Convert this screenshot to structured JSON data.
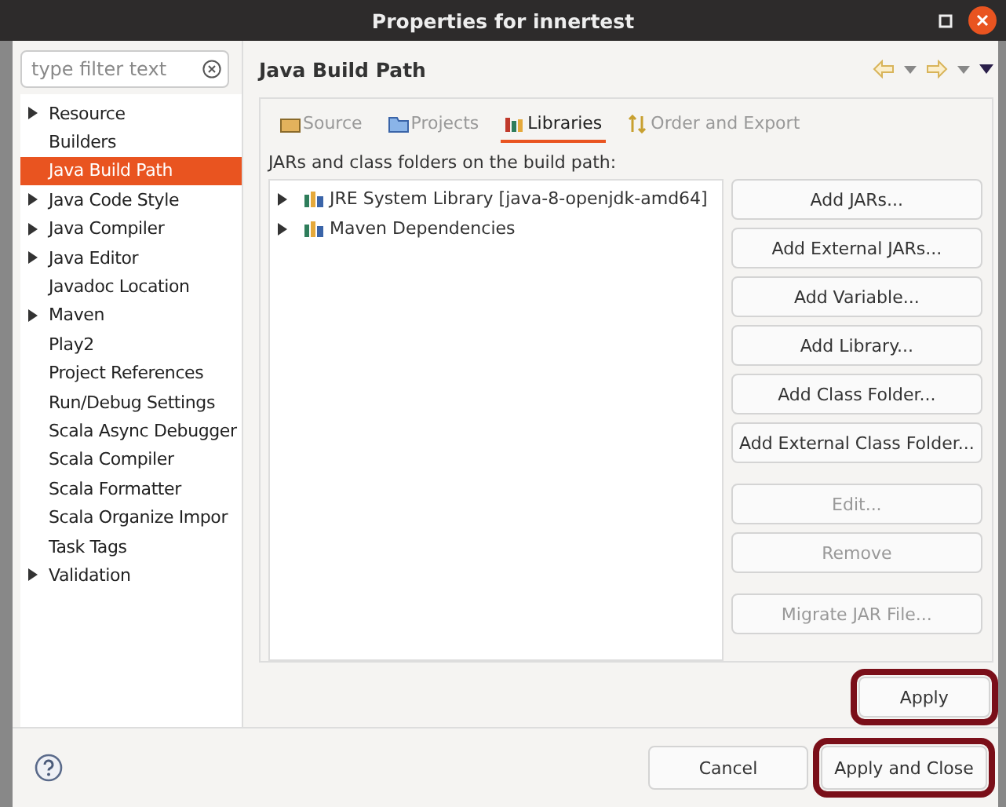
{
  "window": {
    "title": "Properties for innertest"
  },
  "filter": {
    "placeholder": "type filter text"
  },
  "sidebar": {
    "items": [
      {
        "label": "Resource",
        "expandable": true,
        "selected": false
      },
      {
        "label": "Builders",
        "expandable": false,
        "selected": false
      },
      {
        "label": "Java Build Path",
        "expandable": false,
        "selected": true
      },
      {
        "label": "Java Code Style",
        "expandable": true,
        "selected": false
      },
      {
        "label": "Java Compiler",
        "expandable": true,
        "selected": false
      },
      {
        "label": "Java Editor",
        "expandable": true,
        "selected": false
      },
      {
        "label": "Javadoc Location",
        "expandable": false,
        "selected": false
      },
      {
        "label": "Maven",
        "expandable": true,
        "selected": false
      },
      {
        "label": "Play2",
        "expandable": false,
        "selected": false
      },
      {
        "label": "Project References",
        "expandable": false,
        "selected": false
      },
      {
        "label": "Run/Debug Settings",
        "expandable": false,
        "selected": false
      },
      {
        "label": "Scala Async Debugger",
        "expandable": false,
        "selected": false
      },
      {
        "label": "Scala Compiler",
        "expandable": false,
        "selected": false
      },
      {
        "label": "Scala Formatter",
        "expandable": false,
        "selected": false
      },
      {
        "label": "Scala Organize Impor",
        "expandable": false,
        "selected": false
      },
      {
        "label": "Task Tags",
        "expandable": false,
        "selected": false
      },
      {
        "label": "Validation",
        "expandable": true,
        "selected": false
      }
    ]
  },
  "page": {
    "title": "Java Build Path"
  },
  "tabs": [
    {
      "label": "Source",
      "kind": "source",
      "selected": false
    },
    {
      "label": "Projects",
      "kind": "projects",
      "selected": false
    },
    {
      "label": "Libraries",
      "kind": "libraries",
      "selected": true
    },
    {
      "label": "Order and Export",
      "kind": "order",
      "selected": false
    }
  ],
  "list_label": "JARs and class folders on the build path:",
  "libraries": [
    {
      "label": "JRE System Library [java-8-openjdk-amd64]"
    },
    {
      "label": "Maven Dependencies"
    }
  ],
  "side_buttons": [
    {
      "label": "Add JARs...",
      "disabled": false
    },
    {
      "label": "Add External JARs...",
      "disabled": false
    },
    {
      "label": "Add Variable...",
      "disabled": false
    },
    {
      "label": "Add Library...",
      "disabled": false
    },
    {
      "label": "Add Class Folder...",
      "disabled": false
    },
    {
      "label": "Add External Class Folder...",
      "disabled": false
    },
    {
      "label": "Edit...",
      "disabled": true,
      "gap_before": true
    },
    {
      "label": "Remove",
      "disabled": true
    },
    {
      "label": "Migrate JAR File...",
      "disabled": true,
      "gap_before": true
    }
  ],
  "apply": {
    "label": "Apply",
    "highlighted": true
  },
  "footer": {
    "cancel": {
      "label": "Cancel",
      "highlighted": false
    },
    "apply_close": {
      "label": "Apply and Close",
      "highlighted": true
    }
  }
}
